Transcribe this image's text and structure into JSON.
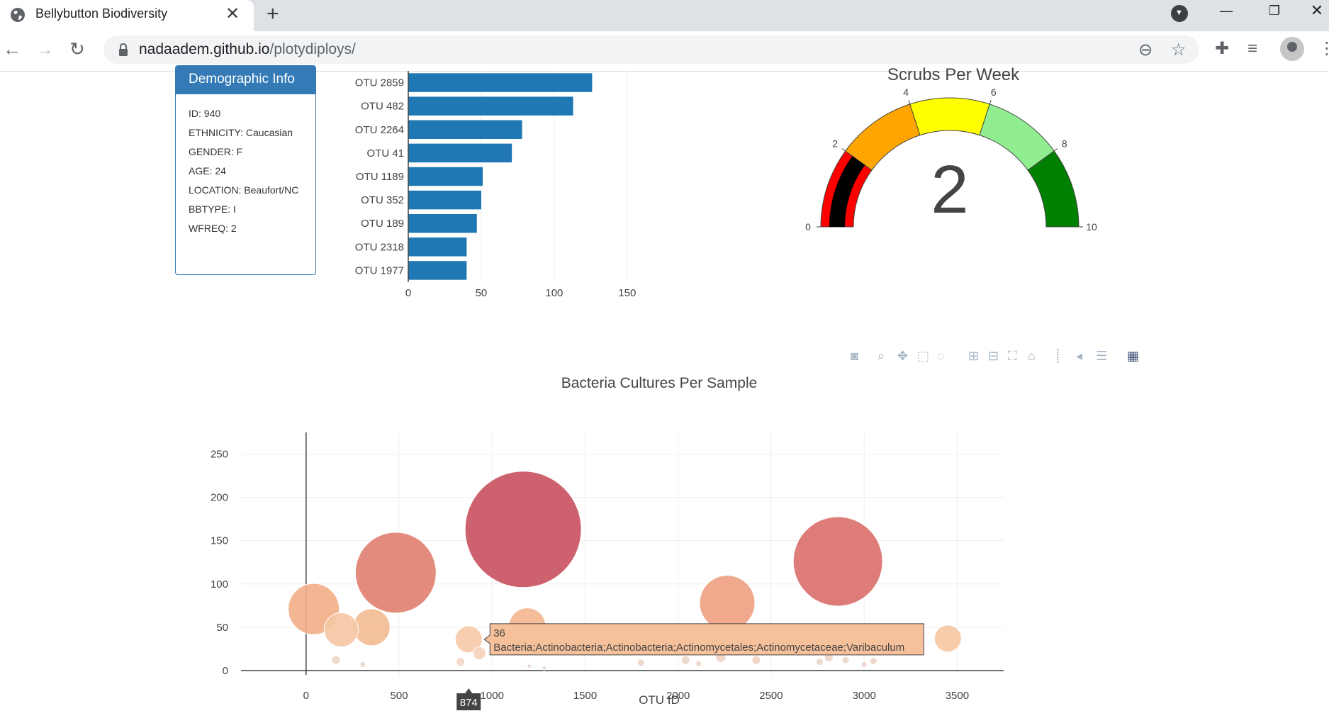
{
  "browser": {
    "tab_title": "Bellybutton Biodiversity",
    "tab_close": "✕",
    "new_tab": "+",
    "url_host": "nadaadem.github.io",
    "url_path": "/plotydiploys/"
  },
  "demographic": {
    "title": "Demographic Info",
    "lines": [
      "ID: 940",
      "ETHNICITY: Caucasian",
      "GENDER: F",
      "AGE: 24",
      "LOCATION: Beaufort/NC",
      "BBTYPE: I",
      "WFREQ: 2"
    ]
  },
  "chart_data": [
    {
      "type": "bar",
      "orientation": "horizontal",
      "categories": [
        "OTU 2859",
        "OTU 482",
        "OTU 2264",
        "OTU 41",
        "OTU 1189",
        "OTU 352",
        "OTU 189",
        "OTU 2318",
        "OTU 1977"
      ],
      "values": [
        126,
        113,
        78,
        71,
        51,
        50,
        47,
        40,
        40
      ],
      "xlim": [
        0,
        170
      ],
      "xticks": [
        0,
        50,
        100,
        150
      ],
      "color": "#1f77b4",
      "grid": true
    },
    {
      "type": "gauge",
      "title": "Scrubs Per Week",
      "value": 2,
      "range": [
        0,
        10
      ],
      "ticks": [
        0,
        2,
        4,
        6,
        8,
        10
      ],
      "steps": [
        {
          "range": [
            0,
            2
          ],
          "color": "#ff0000"
        },
        {
          "range": [
            2,
            4
          ],
          "color": "#ffa500"
        },
        {
          "range": [
            4,
            6
          ],
          "color": "#ffff00"
        },
        {
          "range": [
            6,
            8
          ],
          "color": "#90ee90"
        },
        {
          "range": [
            8,
            10
          ],
          "color": "#008000"
        }
      ],
      "bar_color": "#000000"
    },
    {
      "type": "scatter",
      "mode": "bubble",
      "title": "Bacteria Cultures Per Sample",
      "xlabel": "OTU ID",
      "ylabel": "",
      "xlim": [
        -350,
        3750
      ],
      "ylim": [
        -5,
        275
      ],
      "xticks": [
        0,
        500,
        1000,
        1500,
        2000,
        2500,
        3000,
        3500
      ],
      "yticks": [
        0,
        50,
        100,
        150,
        200,
        250
      ],
      "points": [
        {
          "x": 1167,
          "y": 163,
          "r": 82,
          "color": "#c8505e"
        },
        {
          "x": 2859,
          "y": 126,
          "r": 63,
          "color": "#da6e6a"
        },
        {
          "x": 482,
          "y": 113,
          "r": 57,
          "color": "#e07f70"
        },
        {
          "x": 2264,
          "y": 78,
          "r": 39,
          "color": "#eea07f"
        },
        {
          "x": 41,
          "y": 71,
          "r": 36,
          "color": "#f2ae87"
        },
        {
          "x": 352,
          "y": 50,
          "r": 26,
          "color": "#f3ba92"
        },
        {
          "x": 1189,
          "y": 51,
          "r": 26,
          "color": "#f3b58e"
        },
        {
          "x": 189,
          "y": 47,
          "r": 24,
          "color": "#f5c6a4"
        },
        {
          "x": 874,
          "y": 36,
          "r": 19,
          "color": "#f6c9a6"
        },
        {
          "x": 3450,
          "y": 37,
          "r": 19,
          "color": "#f6c6a2"
        },
        {
          "x": 1977,
          "y": 40,
          "r": 16,
          "color": "#f5c4a2"
        },
        {
          "x": 2318,
          "y": 40,
          "r": 14,
          "color": "#f5cbab"
        },
        {
          "x": 932,
          "y": 20,
          "r": 9,
          "color": "#f4d3bb"
        },
        {
          "x": 830,
          "y": 10,
          "r": 6,
          "color": "#f1d6c6"
        },
        {
          "x": 160,
          "y": 12,
          "r": 6,
          "color": "#eed4c6"
        },
        {
          "x": 305,
          "y": 7,
          "r": 4,
          "color": "#e6d6cc"
        },
        {
          "x": 1200,
          "y": 5,
          "r": 3,
          "color": "#e6d6cc"
        },
        {
          "x": 1280,
          "y": 3,
          "r": 3,
          "color": "#e6d6cc"
        },
        {
          "x": 1800,
          "y": 9,
          "r": 5,
          "color": "#ecd5c8"
        },
        {
          "x": 2040,
          "y": 12,
          "r": 6,
          "color": "#ecd5c8"
        },
        {
          "x": 2110,
          "y": 8,
          "r": 4,
          "color": "#ecd5c8"
        },
        {
          "x": 2230,
          "y": 15,
          "r": 7,
          "color": "#eed3c2"
        },
        {
          "x": 2420,
          "y": 12,
          "r": 6,
          "color": "#eed3c2"
        },
        {
          "x": 2760,
          "y": 10,
          "r": 5,
          "color": "#ecd5c8"
        },
        {
          "x": 2810,
          "y": 15,
          "r": 6,
          "color": "#ecd5c8"
        },
        {
          "x": 2900,
          "y": 12,
          "r": 5,
          "color": "#ecd5c8"
        },
        {
          "x": 3000,
          "y": 7,
          "r": 4,
          "color": "#ecd5c8"
        },
        {
          "x": 3050,
          "y": 11,
          "r": 5,
          "color": "#ecd5c8"
        }
      ],
      "hover": {
        "x_label": "874",
        "y_value": "36",
        "text": "Bacteria;Actinobacteria;Actinobacteria;Actinomycetales;Actinomycetaceae;Varibaculum",
        "color": "#f6c09a"
      }
    }
  ],
  "modebar": {
    "icons": [
      "camera-icon",
      "zoom-icon",
      "pan-icon",
      "box-select-icon",
      "lasso-icon",
      "zoom-in-icon",
      "zoom-out-icon",
      "autoscale-icon",
      "reset-axes-icon",
      "spike-lines-icon",
      "hover-closest-icon",
      "hover-compare-icon",
      "plotly-logo-icon"
    ]
  }
}
